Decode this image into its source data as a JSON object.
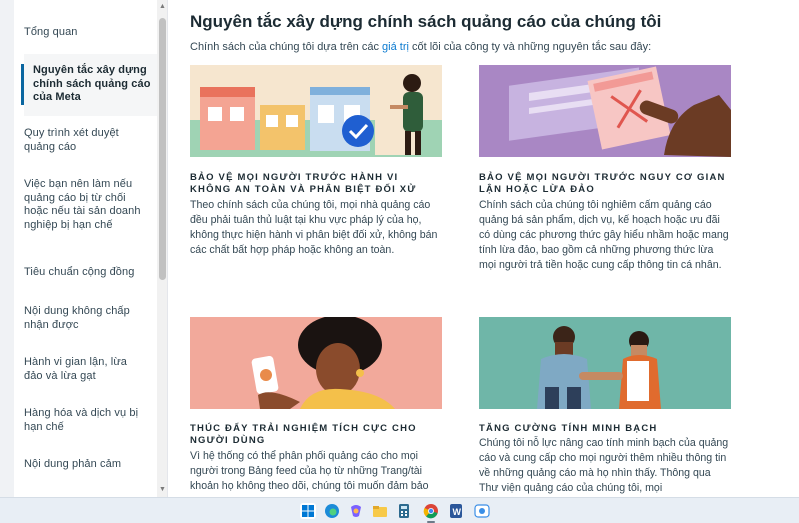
{
  "sidebar": {
    "items": [
      {
        "label": "Tổng quan"
      },
      {
        "label": "Nguyên tắc xây dựng chính sách quảng cáo của Meta"
      },
      {
        "label": "Quy trình xét duyệt quảng cáo"
      },
      {
        "label": "Việc bạn nên làm nếu quảng cáo bị từ chối hoặc nếu tài sản doanh nghiệp bị hạn chế"
      },
      {
        "label": "Tiêu chuẩn cộng đồng"
      },
      {
        "label": "Nội dung không chấp nhận được"
      },
      {
        "label": "Hành vi gian lận, lừa đảo và lừa gạt"
      },
      {
        "label": "Hàng hóa và dịch vụ bị hạn chế"
      },
      {
        "label": "Nội dung phản cảm"
      }
    ]
  },
  "main": {
    "title": "Nguyên tắc xây dựng chính sách quảng cáo của chúng tôi",
    "intro_before": "Chính sách của chúng tôi dựa trên các ",
    "intro_link": "giá trị",
    "intro_after": " cốt lõi của công ty và những nguyên tắc sau đây:",
    "cards": [
      {
        "heading": "BẢO VỆ MỌI NGƯỜI TRƯỚC HÀNH VI KHÔNG AN TOÀN VÀ PHÂN BIỆT ĐỐI XỬ",
        "body": "Theo chính sách của chúng tôi, mọi nhà quảng cáo đều phải tuân thủ luật tại khu vực pháp lý của họ, không thực hiện hành vi phân biệt đối xử, không bán các chất bất hợp pháp hoặc không an toàn."
      },
      {
        "heading": "BẢO VỆ MỌI NGƯỜI TRƯỚC NGUY CƠ GIAN LẬN HOẶC LỪA ĐẢO",
        "body": "Chính sách của chúng tôi nghiêm cấm quảng cáo quảng bá sản phẩm, dịch vụ, kế hoạch hoặc ưu đãi có dùng các phương thức gây hiểu nhầm hoặc mang tính lừa đảo, bao gồm cả những phương thức lừa mọi người trả tiền hoặc cung cấp thông tin cá nhân."
      },
      {
        "heading": "THÚC ĐẨY TRẢI NGHIỆM TÍCH CỰC CHO NGƯỜI DÙNG",
        "body": "Vì hệ thống có thể phân phối quảng cáo cho mọi người trong Bảng feed của họ từ những Trang/tài khoản họ không theo dõi, chúng tôi muốn đảm bảo"
      },
      {
        "heading": "TĂNG CƯỜNG TÍNH MINH BẠCH",
        "body": "Chúng tôi nỗ lực nâng cao tính minh bạch của quảng cáo và cung cấp cho mọi người thêm nhiều thông tin về những quảng cáo mà họ nhìn thấy. Thông qua Thư viện quảng cáo của chúng tôi, mọi"
      }
    ]
  },
  "colors": {
    "accent": "#0a66a0",
    "link": "#0a7ad0",
    "card1_bg": "#f5e7d0",
    "card2_bg": "#a987c4",
    "card3_bg": "#f1a89a",
    "card4_bg": "#6fb6a8"
  },
  "taskbar": {
    "icons": [
      "windows-start-icon",
      "edge-icon",
      "copilot-icon",
      "file-explorer-icon",
      "calculator-icon",
      "chrome-icon",
      "word-icon",
      "other-app-icon"
    ]
  }
}
